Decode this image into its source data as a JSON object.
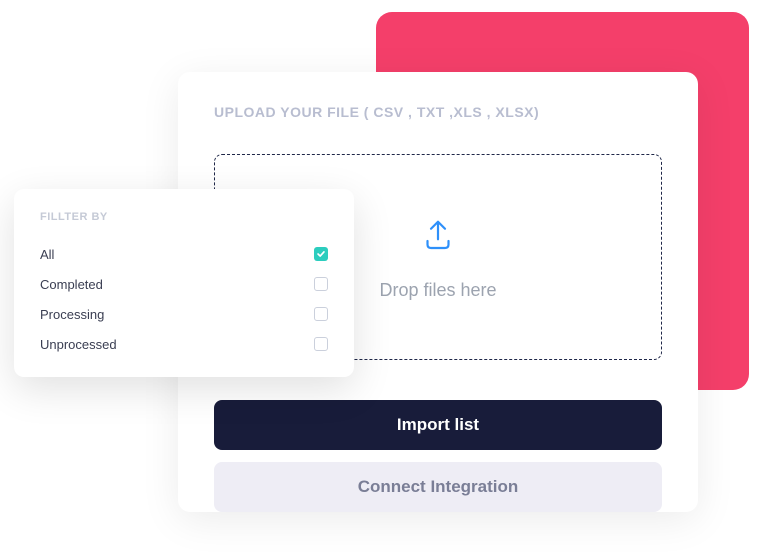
{
  "upload": {
    "title": "UPLOAD YOUR FILE ( CSV , TXT ,XLS , XLSX)",
    "drop_label": "Drop files here",
    "import_label": "Import list",
    "connect_label": "Connect Integration"
  },
  "filter": {
    "heading": "FILLTER BY",
    "items": [
      {
        "label": "All",
        "checked": true
      },
      {
        "label": "Completed",
        "checked": false
      },
      {
        "label": "Processing",
        "checked": false
      },
      {
        "label": "Unprocessed",
        "checked": false
      }
    ]
  },
  "colors": {
    "pink": "#F43F6A",
    "dark": "#181C3A",
    "teal": "#2CCDBE",
    "icon_blue": "#2E90FA"
  }
}
